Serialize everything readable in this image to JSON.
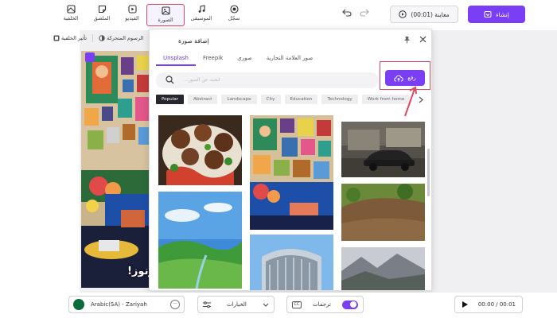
{
  "toolbar": {
    "items": [
      {
        "label": "الخلفية",
        "icon": "background-icon"
      },
      {
        "label": "الملصق",
        "icon": "sticker-icon"
      },
      {
        "label": "الفيديو",
        "icon": "video-icon"
      },
      {
        "label": "الصورة",
        "icon": "image-icon"
      },
      {
        "label": "الموسيقى",
        "icon": "music-icon"
      },
      {
        "label": "سجّل",
        "icon": "record-icon"
      }
    ],
    "preview_label": "معاينة (00:01)",
    "create_label": "إنشاء",
    "accent_color": "#7a3ff5",
    "highlight_color": "#e0465e"
  },
  "context_bar": {
    "background_effect": "تأثير الخلفية",
    "animated_text": "الرسوم المتحركة"
  },
  "canvas": {
    "overlay_text": "دونوز!"
  },
  "modal": {
    "title": "إضافة صورة",
    "tabs": [
      "Unsplash",
      "Freepik",
      "صوري",
      "صور العلامة التجارية"
    ],
    "active_tab": "Unsplash",
    "search_placeholder": "ابحث عن الصور...",
    "upload_label": "رفع",
    "chips": [
      "Popular",
      "Abstract",
      "Landscape",
      "City",
      "Education",
      "Technology",
      "Work from home"
    ],
    "active_chip": "Popular"
  },
  "bottom": {
    "voice_label": "Arabic(SA) - Zariyah",
    "options_label": "الخيارات",
    "subtitles_label": "ترجمات",
    "cc_label": "CC",
    "subtitles_on": true,
    "time": "00:00 / 00:01"
  }
}
